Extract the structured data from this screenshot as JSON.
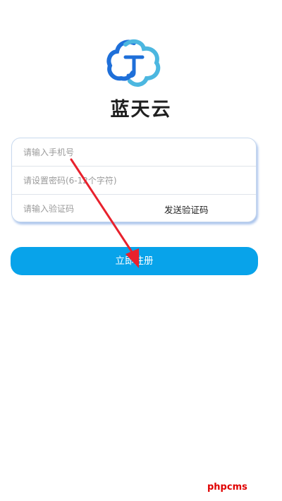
{
  "app": {
    "name": "蓝天云",
    "logo_icon": "cloud-logo-icon",
    "colors": {
      "accent": "#08a3ea",
      "logo_blue": "#1e6fd9",
      "logo_cyan": "#4cb7e0"
    }
  },
  "form": {
    "phone": {
      "placeholder": "请输入手机号",
      "value": ""
    },
    "password": {
      "placeholder": "请设置密码(6-12个字符)",
      "value": ""
    },
    "code": {
      "placeholder": "请输入验证码",
      "value": ""
    },
    "send_code_label": "发送验证码"
  },
  "submit_label": "立即注册",
  "annotation": {
    "arrow_color": "#e8212d",
    "arrow_icon": "red-arrow-icon"
  },
  "watermark": "phpcms"
}
